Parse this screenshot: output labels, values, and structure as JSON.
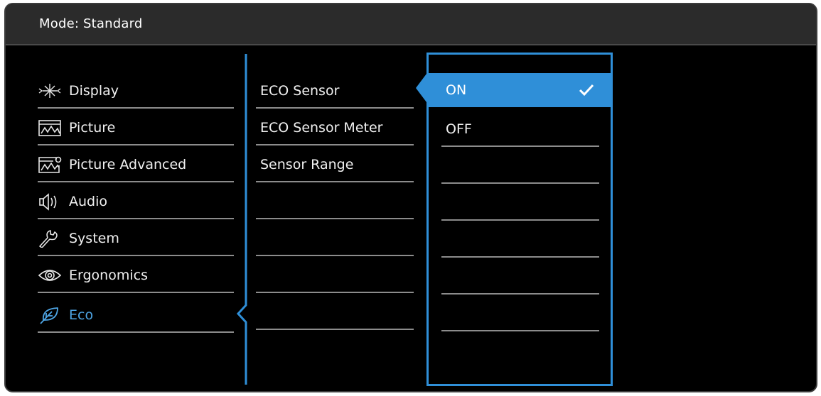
{
  "header": {
    "mode_label": "Mode: Standard"
  },
  "menu": {
    "items": [
      {
        "label": "Display",
        "icon": "display-icon"
      },
      {
        "label": "Picture",
        "icon": "picture-icon"
      },
      {
        "label": "Picture Advanced",
        "icon": "picture-advanced-icon"
      },
      {
        "label": "Audio",
        "icon": "speaker-icon"
      },
      {
        "label": "System",
        "icon": "wrench-icon"
      },
      {
        "label": "Ergonomics",
        "icon": "eye-icon"
      },
      {
        "label": "Eco",
        "icon": "leaf-icon",
        "active": true
      }
    ]
  },
  "submenu": {
    "items": [
      {
        "label": "ECO Sensor"
      },
      {
        "label": "ECO Sensor Meter"
      },
      {
        "label": "Sensor Range"
      }
    ]
  },
  "options": {
    "items": [
      {
        "label": "ON",
        "selected": true
      },
      {
        "label": "OFF"
      }
    ]
  },
  "colors": {
    "accent": "#2f8fd8",
    "active_text": "#4ea6e6",
    "background": "#000000",
    "header": "#2b2b2b"
  }
}
